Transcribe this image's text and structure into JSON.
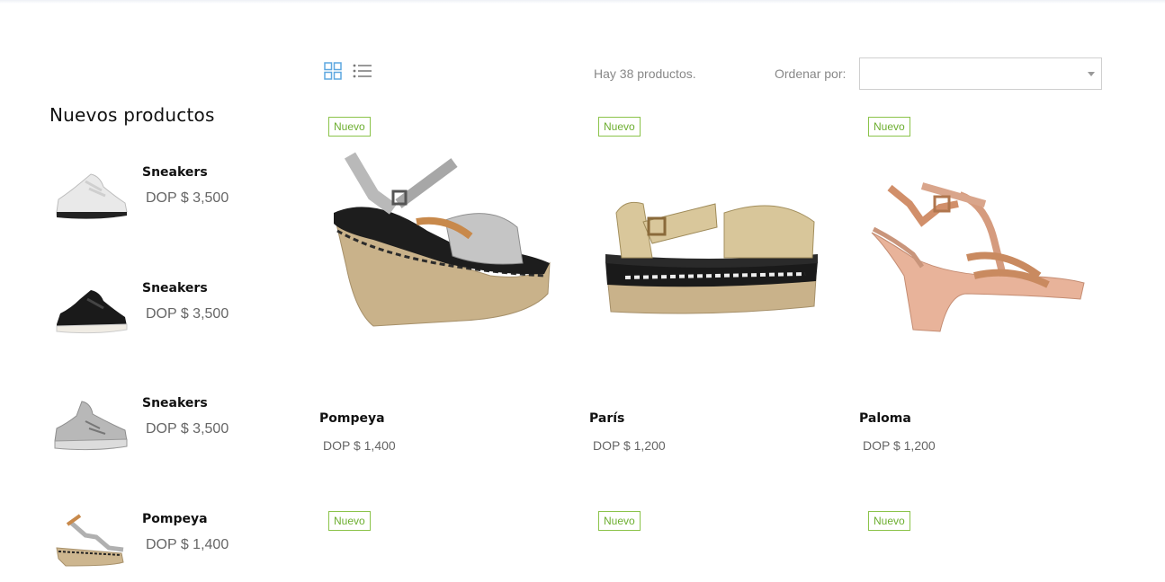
{
  "sidebar": {
    "title": "Nuevos productos",
    "items": [
      {
        "name": "Sneakers",
        "price": "DOP $ 3,500",
        "image": "white-sneaker"
      },
      {
        "name": "Sneakers",
        "price": "DOP $ 3,500",
        "image": "black-sneaker"
      },
      {
        "name": "Sneakers",
        "price": "DOP $ 3,500",
        "image": "grey-sneaker"
      },
      {
        "name": "Pompeya",
        "price": "DOP $ 1,400",
        "image": "silver-wedge"
      }
    ]
  },
  "toolbar": {
    "grid_icon": "grid-view-icon",
    "list_icon": "list-view-icon",
    "count": "Hay 38 productos.",
    "sort_label": "Ordenar por:",
    "sort_value": ""
  },
  "products": [
    {
      "badge": "Nuevo",
      "name": "Pompeya",
      "price": "DOP $ 1,400",
      "image": "silver-espadrille-wedge"
    },
    {
      "badge": "Nuevo",
      "name": "París",
      "price": "DOP $ 1,200",
      "image": "gold-flatform-sandal"
    },
    {
      "badge": "Nuevo",
      "name": "Paloma",
      "price": "DOP $ 1,200",
      "image": "rose-gold-wedge"
    },
    {
      "badge": "Nuevo"
    },
    {
      "badge": "Nuevo"
    },
    {
      "badge": "Nuevo"
    }
  ],
  "colors": {
    "accent": "#5fa8e0",
    "badge": "#8bc34a",
    "text": "#111111",
    "muted": "#888888"
  }
}
